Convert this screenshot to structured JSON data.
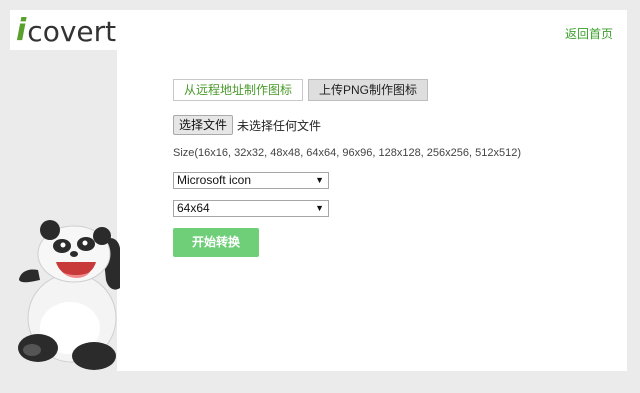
{
  "logo": {
    "letter": "i",
    "rest": "covert"
  },
  "header": {
    "home_link": "返回首页"
  },
  "tabs": [
    {
      "label": "从远程地址制作图标",
      "active": true
    },
    {
      "label": "上传PNG制作图标",
      "active": false
    }
  ],
  "file": {
    "button_label": "选择文件",
    "status": "未选择任何文件"
  },
  "sizes_text": "Size(16x16, 32x32, 48x48, 64x64, 96x96, 128x128, 256x256, 512x512)",
  "format_select": {
    "value": "Microsoft icon"
  },
  "size_select": {
    "value": "64x64"
  },
  "convert_button": "开始转换",
  "colors": {
    "accent": "#3aa02a",
    "button": "#6fcf79",
    "background": "#ebebeb"
  }
}
